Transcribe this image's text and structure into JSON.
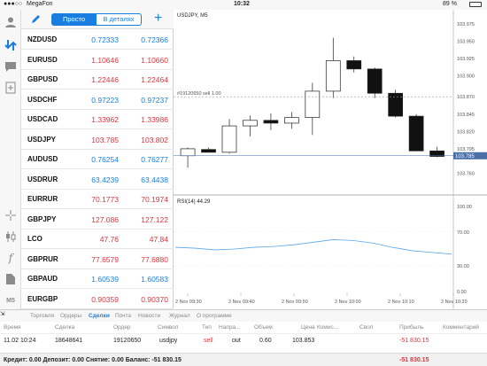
{
  "status_bar": {
    "carrier": "MegaFon",
    "time": "10:32",
    "battery": "89 %"
  },
  "quotes_toolbar": {
    "tab_simple": "Просто",
    "tab_detail": "В деталях"
  },
  "rail": {
    "bottom_label": "M5"
  },
  "quotes": [
    {
      "symbol": "NZDUSD",
      "bid": "0.72333",
      "ask": "0.72366",
      "color": "#1a7ee0"
    },
    {
      "symbol": "EURUSD",
      "bid": "1.10646",
      "ask": "1.10660",
      "color": "#d9363e"
    },
    {
      "symbol": "GBPUSD",
      "bid": "1.22446",
      "ask": "1.22464",
      "color": "#d9363e"
    },
    {
      "symbol": "USDCHF",
      "bid": "0.97223",
      "ask": "0.97237",
      "color": "#1a7ee0"
    },
    {
      "symbol": "USDCAD",
      "bid": "1.33962",
      "ask": "1.33986",
      "color": "#d9363e"
    },
    {
      "symbol": "USDJPY",
      "bid": "103.785",
      "ask": "103.802",
      "color": "#d9363e"
    },
    {
      "symbol": "AUDUSD",
      "bid": "0.76254",
      "ask": "0.76277",
      "color": "#1a7ee0"
    },
    {
      "symbol": "USDRUR",
      "bid": "63.4239",
      "ask": "63.4438",
      "color": "#1a7ee0"
    },
    {
      "symbol": "EURRUR",
      "bid": "70.1773",
      "ask": "70.1974",
      "color": "#d9363e"
    },
    {
      "symbol": "GBPJPY",
      "bid": "127.086",
      "ask": "127.122",
      "color": "#d9363e"
    },
    {
      "symbol": "LCO",
      "bid": "47.76",
      "ask": "47.84",
      "color": "#d9363e"
    },
    {
      "symbol": "GBPRUR",
      "bid": "77.6579",
      "ask": "77.6880",
      "color": "#d9363e"
    },
    {
      "symbol": "GBPAUD",
      "bid": "1.60539",
      "ask": "1.60583",
      "color": "#1a7ee0"
    },
    {
      "symbol": "EURGBP",
      "bid": "0.90359",
      "ask": "0.90370",
      "color": "#d9363e"
    }
  ],
  "chart": {
    "symbol_label": "USDJPY, M5",
    "order_label": "#19120650 sell 1.00",
    "rsi_label": "RSI(14) 44.29",
    "current_price_label": "103.785"
  },
  "chart_data": [
    {
      "type": "candlestick",
      "title": "USDJPY, M5",
      "x": [
        "2 Nov 09:30",
        "2 Nov 09:40",
        "2 Nov 09:50",
        "2 Nov 10:00",
        "2 Nov 10:10",
        "2 Nov 10:20"
      ],
      "ylim": [
        103.74,
        103.98
      ],
      "yticks": [
        "103.975",
        "103.950",
        "103.925",
        "103.900",
        "103.870",
        "103.845",
        "103.820",
        "103.795",
        "103.760"
      ],
      "candles": [
        {
          "open": 103.785,
          "high": 103.797,
          "low": 103.768,
          "close": 103.795
        },
        {
          "open": 103.794,
          "high": 103.797,
          "low": 103.79,
          "close": 103.79
        },
        {
          "open": 103.79,
          "high": 103.838,
          "low": 103.788,
          "close": 103.828
        },
        {
          "open": 103.828,
          "high": 103.843,
          "low": 103.813,
          "close": 103.836
        },
        {
          "open": 103.836,
          "high": 103.846,
          "low": 103.822,
          "close": 103.832
        },
        {
          "open": 103.832,
          "high": 103.848,
          "low": 103.824,
          "close": 103.84
        },
        {
          "open": 103.84,
          "high": 103.89,
          "low": 103.815,
          "close": 103.878
        },
        {
          "open": 103.878,
          "high": 103.955,
          "low": 103.868,
          "close": 103.922
        },
        {
          "open": 103.922,
          "high": 103.928,
          "low": 103.905,
          "close": 103.91
        },
        {
          "open": 103.91,
          "high": 103.912,
          "low": 103.868,
          "close": 103.875
        },
        {
          "open": 103.875,
          "high": 103.88,
          "low": 103.84,
          "close": 103.842
        },
        {
          "open": 103.842,
          "high": 103.845,
          "low": 103.793,
          "close": 103.792
        },
        {
          "open": 103.792,
          "high": 103.798,
          "low": 103.783,
          "close": 103.784
        }
      ],
      "order_line_price": 103.87,
      "current_price": 103.785
    },
    {
      "type": "line",
      "title": "RSI(14) 44.29",
      "ylim": [
        0,
        100
      ],
      "yticks": [
        "100.00",
        "70.00",
        "30.00",
        "0.00"
      ],
      "values": [
        52,
        51,
        49,
        50,
        52,
        53,
        55,
        58,
        61,
        60,
        57,
        52,
        48,
        46,
        44
      ]
    }
  ],
  "tabs": [
    "Торговля",
    "Ордеры",
    "Сделки",
    "Почта",
    "Новости",
    "Журнал",
    "О программе"
  ],
  "active_tab": "Сделки",
  "trades": {
    "headers": [
      "Время",
      "Сделка",
      "Ордер",
      "Символ",
      "Тип",
      "Напра...",
      "Объем",
      "Цена",
      "Комис...",
      "Своп",
      "Прибыль",
      "Комментарий"
    ],
    "row": {
      "time": "11.02 10:24",
      "deal": "18648641",
      "order": "19120650",
      "symbol": "usdjpy",
      "type": "sell",
      "direction": "out",
      "volume": "0.60",
      "price": "103.853",
      "profit": "-51 830.15"
    }
  },
  "summary": {
    "text": "Кредит: 0.00 Депозит: 0.00 Снятие: 0.00 Баланс: -51 830.15",
    "total": "-51 830.15"
  }
}
